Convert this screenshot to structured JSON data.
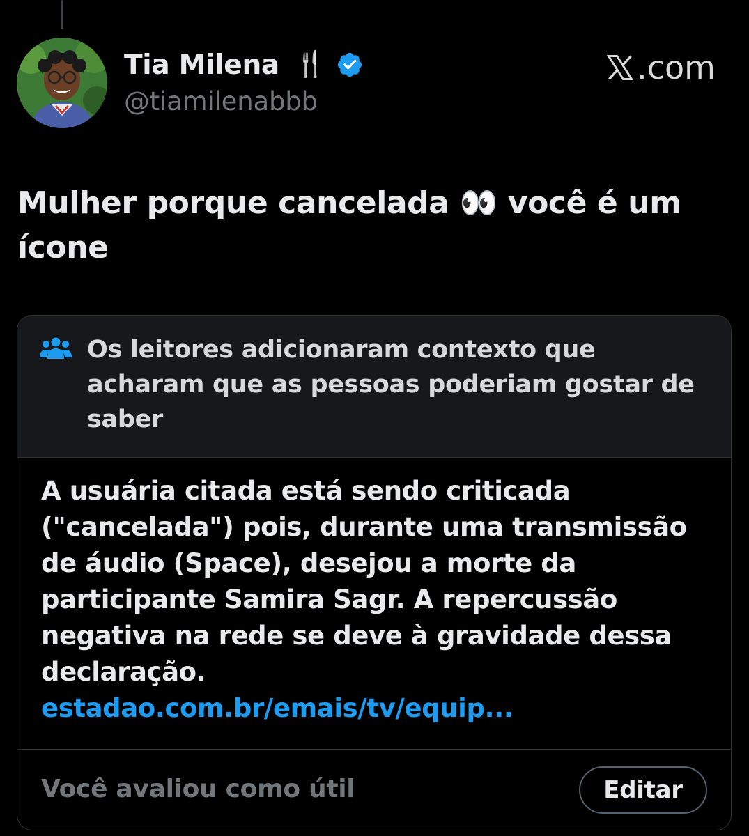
{
  "tweet": {
    "author": {
      "display_name": "Tia Milena",
      "name_emoji": "🍴",
      "handle": "@tiamilenabbb",
      "verified": true,
      "verified_color": "#1d9bf0"
    },
    "brand": {
      "logo_icon": "x-logo-icon",
      "suffix": ".com"
    },
    "text_part1": "Mulher porque cancelada 👀 você é um ícone"
  },
  "community_note": {
    "header_icon": "people-icon",
    "header_text": "Os leitores adicionaram contexto que acharam que as pessoas poderiam gostar de saber",
    "body_text": "A usuária citada está sendo criticada (\"cancelada\") pois, durante uma transmissão de áudio (Space), desejou a morte da participante Samira Sagr. A repercussão negativa na rede se deve à gravidade dessa declaração.",
    "link_text": "estadao.com.br/emais/tv/equip...",
    "link_color": "#1d9bf0",
    "rated_text": "Você avaliou como útil",
    "edit_label": "Editar"
  },
  "colors": {
    "background": "#000000",
    "text_primary": "#e7e9ea",
    "text_secondary": "#71767b",
    "card_header_bg": "#16181c",
    "border": "#2f3336"
  }
}
